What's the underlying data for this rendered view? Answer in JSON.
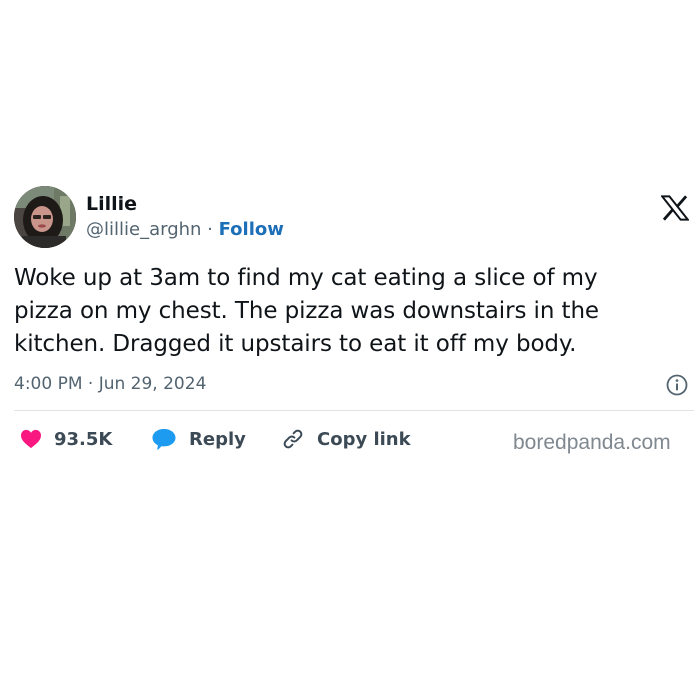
{
  "tweet": {
    "author": {
      "name": "Lillie",
      "handle": "@lillie_arghn",
      "separator": " · ",
      "follow_label": "Follow",
      "avatar_icon": "profile-photo"
    },
    "brand_icon": "x-logo-icon",
    "text": "Woke up at 3am to find my cat eating a slice of my\npizza on my chest. The pizza was downstairs in the\nkitchen. Dragged it upstairs to eat it off my body.",
    "timestamp": "4:00 PM · Jun 29, 2024",
    "actions": {
      "likes": {
        "icon": "heart-icon",
        "label": "93.5K"
      },
      "reply": {
        "icon": "speech-bubble-icon",
        "label": "Reply"
      },
      "copy": {
        "icon": "link-icon",
        "label": "Copy link"
      }
    }
  },
  "watermark": "boredpanda.com",
  "colors": {
    "like": "#f91880",
    "reply": "#1d9bf0",
    "follow": "#1d6fb8",
    "secondary_text": "#536471",
    "divider": "#dfe3e6"
  }
}
